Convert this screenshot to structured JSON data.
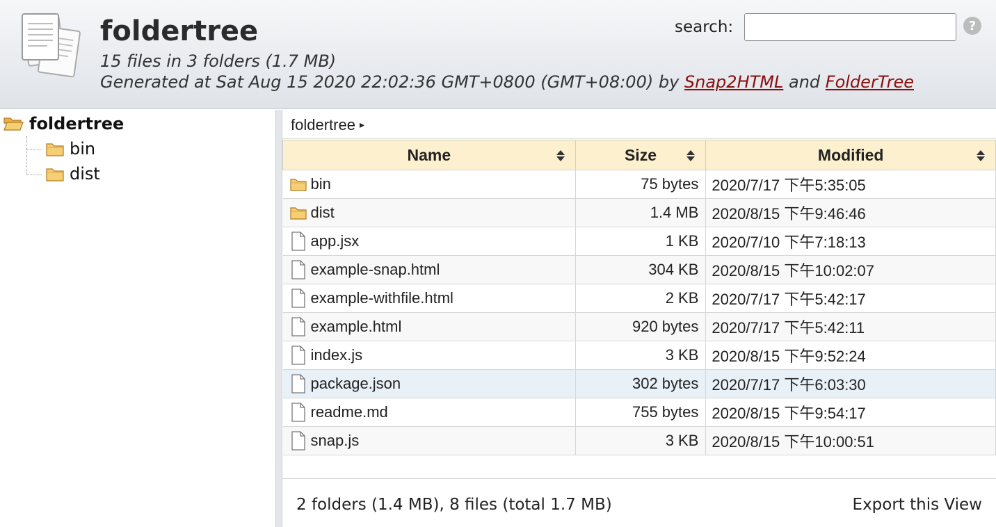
{
  "header": {
    "title": "foldertree",
    "summary": "15 files in 3 folders (1.7 MB)",
    "generated_prefix": "Generated at Sat Aug 15 2020 22:02:36 GMT+0800 (GMT+08:00) by ",
    "link1": "Snap2HTML",
    "and_text": " and ",
    "link2": "FolderTree",
    "search_label": "search:",
    "search_value": "",
    "help_icon": "question-circle-icon"
  },
  "tree": {
    "root": "foldertree",
    "children": [
      "bin",
      "dist"
    ]
  },
  "breadcrumb": {
    "path": "foldertree",
    "arrow": "▸"
  },
  "table": {
    "columns": [
      "Name",
      "Size",
      "Modified"
    ],
    "rows": [
      {
        "type": "folder",
        "name": "bin",
        "size": "75 bytes",
        "modified": "2020/7/17 下午5:35:05"
      },
      {
        "type": "folder",
        "name": "dist",
        "size": "1.4 MB",
        "modified": "2020/8/15 下午9:46:46"
      },
      {
        "type": "file",
        "name": "app.jsx",
        "size": "1 KB",
        "modified": "2020/7/10 下午7:18:13"
      },
      {
        "type": "file",
        "name": "example-snap.html",
        "size": "304 KB",
        "modified": "2020/8/15 下午10:02:07"
      },
      {
        "type": "file",
        "name": "example-withfile.html",
        "size": "2 KB",
        "modified": "2020/7/17 下午5:42:17"
      },
      {
        "type": "file",
        "name": "example.html",
        "size": "920 bytes",
        "modified": "2020/7/17 下午5:42:11"
      },
      {
        "type": "file",
        "name": "index.js",
        "size": "3 KB",
        "modified": "2020/8/15 下午9:52:24"
      },
      {
        "type": "file",
        "name": "package.json",
        "size": "302 bytes",
        "modified": "2020/7/17 下午6:03:30"
      },
      {
        "type": "file",
        "name": "readme.md",
        "size": "755 bytes",
        "modified": "2020/8/15 下午9:54:17"
      },
      {
        "type": "file",
        "name": "snap.js",
        "size": "3 KB",
        "modified": "2020/8/15 下午10:00:51"
      }
    ]
  },
  "footer": {
    "summary": "2 folders (1.4 MB), 8 files (total 1.7 MB)",
    "export_label": "Export this View"
  },
  "colors": {
    "link": "#8b0e0e",
    "header_bg": "#dfe3e8",
    "table_header_bg": "#fdf0cf",
    "folder": "#f2c45a",
    "row_highlight": "#e8f0f8"
  }
}
